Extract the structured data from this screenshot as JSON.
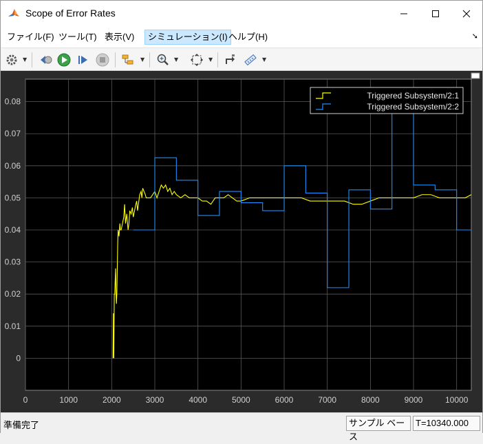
{
  "window": {
    "title": "Scope of Error Rates"
  },
  "menu": [
    {
      "label": "ファイル(F)"
    },
    {
      "label": "ツール(T)"
    },
    {
      "label": "表示(V)"
    },
    {
      "label": "シミュレーション(I)"
    },
    {
      "label": "ヘルプ(H)"
    }
  ],
  "active_menu_index": 3,
  "toolbar_icons": [
    "settings-icon",
    "step-back-icon",
    "run-icon",
    "step-forward-icon",
    "stop-icon",
    "highlight-block-icon",
    "zoom-icon",
    "fit-view-icon",
    "restore-icon",
    "measurement-icon"
  ],
  "status": {
    "left": "準備完了",
    "sample_mode": "サンプル ベース",
    "time": "T=10340.000"
  },
  "colors": {
    "plot_bg": "#000000",
    "axes_bg": "#2b2b2b",
    "grid": "#5a5a5a",
    "series1": "#ffff00",
    "series2": "#1e90ff",
    "menu_highlight": "#cce8ff"
  },
  "chart_data": {
    "type": "line",
    "title": "",
    "xlabel": "",
    "ylabel": "",
    "xlim": [
      0,
      10340
    ],
    "ylim": [
      -0.01,
      0.087
    ],
    "x_ticks": [
      "0",
      "1000",
      "2000",
      "3000",
      "4000",
      "5000",
      "6000",
      "7000",
      "8000",
      "9000",
      "10000"
    ],
    "x_tick_values": [
      0,
      1000,
      2000,
      3000,
      4000,
      5000,
      6000,
      7000,
      8000,
      9000,
      10000
    ],
    "y_ticks": [
      "0",
      "0.01",
      "0.02",
      "0.03",
      "0.04",
      "0.05",
      "0.06",
      "0.07",
      "0.08"
    ],
    "y_tick_values": [
      0,
      0.01,
      0.02,
      0.03,
      0.04,
      0.05,
      0.06,
      0.07,
      0.08
    ],
    "grid": true,
    "legend": "top-right",
    "series": [
      {
        "name": "Triggered Subsystem/2:1",
        "style": "line",
        "color": "#ffff00",
        "x": [
          2030,
          2040,
          2050,
          2060,
          2070,
          2090,
          2100,
          2110,
          2120,
          2140,
          2150,
          2170,
          2190,
          2200,
          2220,
          2250,
          2280,
          2300,
          2320,
          2350,
          2380,
          2400,
          2420,
          2450,
          2480,
          2500,
          2530,
          2560,
          2580,
          2600,
          2620,
          2650,
          2680,
          2700,
          2720,
          2750,
          2780,
          2800,
          2850,
          2900,
          2950,
          3000,
          3050,
          3100,
          3150,
          3200,
          3250,
          3300,
          3350,
          3400,
          3450,
          3500,
          3600,
          3700,
          3800,
          3900,
          4000,
          4100,
          4200,
          4300,
          4400,
          4500,
          4600,
          4700,
          4800,
          4900,
          5000,
          5200,
          5400,
          5600,
          5800,
          6000,
          6200,
          6400,
          6600,
          6800,
          7000,
          7200,
          7400,
          7600,
          7800,
          8000,
          8200,
          8400,
          8600,
          8800,
          9000,
          9200,
          9400,
          9600,
          9800,
          10000,
          10200,
          10340
        ],
        "y": [
          0.0,
          0.014,
          0.0,
          0.02,
          0.02,
          0.028,
          0.02,
          0.017,
          0.02,
          0.036,
          0.04,
          0.038,
          0.042,
          0.04,
          0.04,
          0.042,
          0.044,
          0.048,
          0.042,
          0.045,
          0.04,
          0.042,
          0.046,
          0.045,
          0.047,
          0.044,
          0.046,
          0.048,
          0.049,
          0.046,
          0.048,
          0.051,
          0.052,
          0.05,
          0.053,
          0.052,
          0.051,
          0.05,
          0.05,
          0.05,
          0.051,
          0.052,
          0.05,
          0.052,
          0.054,
          0.053,
          0.054,
          0.052,
          0.053,
          0.051,
          0.052,
          0.051,
          0.05,
          0.051,
          0.05,
          0.05,
          0.05,
          0.049,
          0.049,
          0.048,
          0.05,
          0.05,
          0.05,
          0.051,
          0.05,
          0.049,
          0.049,
          0.05,
          0.05,
          0.05,
          0.05,
          0.05,
          0.05,
          0.05,
          0.049,
          0.049,
          0.049,
          0.049,
          0.049,
          0.048,
          0.048,
          0.049,
          0.05,
          0.05,
          0.05,
          0.05,
          0.05,
          0.051,
          0.051,
          0.05,
          0.05,
          0.05,
          0.05,
          0.051
        ]
      },
      {
        "name": "Triggered Subsystem/2:2",
        "style": "step",
        "color": "#1e90ff",
        "x": [
          2500,
          3000,
          3500,
          4000,
          4500,
          5000,
          5500,
          6000,
          6500,
          7000,
          7500,
          8000,
          8500,
          9000,
          9500,
          10000,
          10340
        ],
        "y": [
          0.04,
          0.0625,
          0.0555,
          0.0445,
          0.052,
          0.0485,
          0.046,
          0.06,
          0.0515,
          0.022,
          0.0525,
          0.0465,
          0.08,
          0.054,
          0.0525,
          0.04,
          0.04
        ]
      }
    ]
  }
}
